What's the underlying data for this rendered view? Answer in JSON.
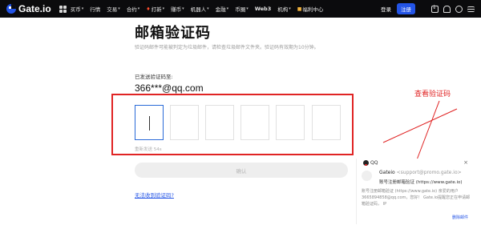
{
  "header": {
    "logo_text": "Gate.io",
    "nav": [
      {
        "label": "买币",
        "caret": true
      },
      {
        "label": "行情",
        "caret": false
      },
      {
        "label": "交易",
        "caret": true
      },
      {
        "label": "合约",
        "caret": true
      },
      {
        "label": "打新",
        "caret": true,
        "icon": "flame-icon"
      },
      {
        "label": "赚币",
        "caret": true
      },
      {
        "label": "机器人",
        "caret": true
      },
      {
        "label": "金融",
        "caret": true
      },
      {
        "label": "币圈",
        "caret": true
      },
      {
        "label": "Web3",
        "caret": false
      },
      {
        "label": "机构",
        "caret": true
      },
      {
        "label": "福利中心",
        "caret": false,
        "icon": "gift-icon"
      }
    ],
    "login_label": "登录",
    "register_label": "注册",
    "icons": [
      "download-icon",
      "bell-icon",
      "globe-icon",
      "menu-icon"
    ]
  },
  "main": {
    "title": "邮箱验证码",
    "description": "验证码邮件可能被判定为垃圾邮件，请检查垃圾邮件文件夹。验证码有效期为10分钟。",
    "sent_label": "已发送验证码至:",
    "email": "366***@qq.com",
    "code_boxes": [
      "",
      "",
      "",
      "",
      "",
      ""
    ],
    "resend_text": "重新发送 54s",
    "confirm_label": "确认",
    "no_code_link": "无法收到验证码?"
  },
  "annotation": {
    "text": "查看验证码",
    "color": "#e02424"
  },
  "notification": {
    "app": "QQ",
    "sender_name": "Gateio",
    "sender_address": "<support@promo.gate.io>",
    "subject": "账号注册邮箱验证 (https://www.gate.io)",
    "body": "账号注册邮箱验证 (https://www.gate.io)    亲爱的用户3665894858@qq.com，您好！ Gate.io提醒您正在申请邮箱验证码，    IP",
    "delete_label": "删除邮件",
    "close_label": "×"
  },
  "colors": {
    "accent": "#2354e6",
    "annotation_red": "#e02424",
    "topbar": "#0b0b0d"
  }
}
